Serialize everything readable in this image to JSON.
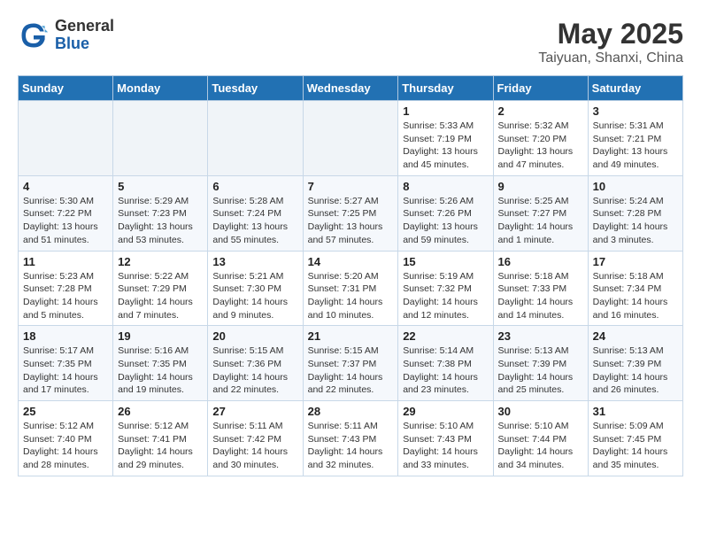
{
  "header": {
    "logo_general": "General",
    "logo_blue": "Blue",
    "title": "May 2025",
    "subtitle": "Taiyuan, Shanxi, China"
  },
  "days_of_week": [
    "Sunday",
    "Monday",
    "Tuesday",
    "Wednesday",
    "Thursday",
    "Friday",
    "Saturday"
  ],
  "weeks": [
    [
      {
        "day": "",
        "empty": true
      },
      {
        "day": "",
        "empty": true
      },
      {
        "day": "",
        "empty": true
      },
      {
        "day": "",
        "empty": true
      },
      {
        "day": "1",
        "sunrise": "5:33 AM",
        "sunset": "7:19 PM",
        "daylight": "13 hours and 45 minutes."
      },
      {
        "day": "2",
        "sunrise": "5:32 AM",
        "sunset": "7:20 PM",
        "daylight": "13 hours and 47 minutes."
      },
      {
        "day": "3",
        "sunrise": "5:31 AM",
        "sunset": "7:21 PM",
        "daylight": "13 hours and 49 minutes."
      }
    ],
    [
      {
        "day": "4",
        "sunrise": "5:30 AM",
        "sunset": "7:22 PM",
        "daylight": "13 hours and 51 minutes."
      },
      {
        "day": "5",
        "sunrise": "5:29 AM",
        "sunset": "7:23 PM",
        "daylight": "13 hours and 53 minutes."
      },
      {
        "day": "6",
        "sunrise": "5:28 AM",
        "sunset": "7:24 PM",
        "daylight": "13 hours and 55 minutes."
      },
      {
        "day": "7",
        "sunrise": "5:27 AM",
        "sunset": "7:25 PM",
        "daylight": "13 hours and 57 minutes."
      },
      {
        "day": "8",
        "sunrise": "5:26 AM",
        "sunset": "7:26 PM",
        "daylight": "13 hours and 59 minutes."
      },
      {
        "day": "9",
        "sunrise": "5:25 AM",
        "sunset": "7:27 PM",
        "daylight": "14 hours and 1 minute."
      },
      {
        "day": "10",
        "sunrise": "5:24 AM",
        "sunset": "7:28 PM",
        "daylight": "14 hours and 3 minutes."
      }
    ],
    [
      {
        "day": "11",
        "sunrise": "5:23 AM",
        "sunset": "7:28 PM",
        "daylight": "14 hours and 5 minutes."
      },
      {
        "day": "12",
        "sunrise": "5:22 AM",
        "sunset": "7:29 PM",
        "daylight": "14 hours and 7 minutes."
      },
      {
        "day": "13",
        "sunrise": "5:21 AM",
        "sunset": "7:30 PM",
        "daylight": "14 hours and 9 minutes."
      },
      {
        "day": "14",
        "sunrise": "5:20 AM",
        "sunset": "7:31 PM",
        "daylight": "14 hours and 10 minutes."
      },
      {
        "day": "15",
        "sunrise": "5:19 AM",
        "sunset": "7:32 PM",
        "daylight": "14 hours and 12 minutes."
      },
      {
        "day": "16",
        "sunrise": "5:18 AM",
        "sunset": "7:33 PM",
        "daylight": "14 hours and 14 minutes."
      },
      {
        "day": "17",
        "sunrise": "5:18 AM",
        "sunset": "7:34 PM",
        "daylight": "14 hours and 16 minutes."
      }
    ],
    [
      {
        "day": "18",
        "sunrise": "5:17 AM",
        "sunset": "7:35 PM",
        "daylight": "14 hours and 17 minutes."
      },
      {
        "day": "19",
        "sunrise": "5:16 AM",
        "sunset": "7:35 PM",
        "daylight": "14 hours and 19 minutes."
      },
      {
        "day": "20",
        "sunrise": "5:15 AM",
        "sunset": "7:36 PM",
        "daylight": "14 hours and 22 minutes."
      },
      {
        "day": "21",
        "sunrise": "5:15 AM",
        "sunset": "7:37 PM",
        "daylight": "14 hours and 22 minutes."
      },
      {
        "day": "22",
        "sunrise": "5:14 AM",
        "sunset": "7:38 PM",
        "daylight": "14 hours and 23 minutes."
      },
      {
        "day": "23",
        "sunrise": "5:13 AM",
        "sunset": "7:39 PM",
        "daylight": "14 hours and 25 minutes."
      },
      {
        "day": "24",
        "sunrise": "5:13 AM",
        "sunset": "7:39 PM",
        "daylight": "14 hours and 26 minutes."
      }
    ],
    [
      {
        "day": "25",
        "sunrise": "5:12 AM",
        "sunset": "7:40 PM",
        "daylight": "14 hours and 28 minutes."
      },
      {
        "day": "26",
        "sunrise": "5:12 AM",
        "sunset": "7:41 PM",
        "daylight": "14 hours and 29 minutes."
      },
      {
        "day": "27",
        "sunrise": "5:11 AM",
        "sunset": "7:42 PM",
        "daylight": "14 hours and 30 minutes."
      },
      {
        "day": "28",
        "sunrise": "5:11 AM",
        "sunset": "7:43 PM",
        "daylight": "14 hours and 32 minutes."
      },
      {
        "day": "29",
        "sunrise": "5:10 AM",
        "sunset": "7:43 PM",
        "daylight": "14 hours and 33 minutes."
      },
      {
        "day": "30",
        "sunrise": "5:10 AM",
        "sunset": "7:44 PM",
        "daylight": "14 hours and 34 minutes."
      },
      {
        "day": "31",
        "sunrise": "5:09 AM",
        "sunset": "7:45 PM",
        "daylight": "14 hours and 35 minutes."
      }
    ]
  ]
}
